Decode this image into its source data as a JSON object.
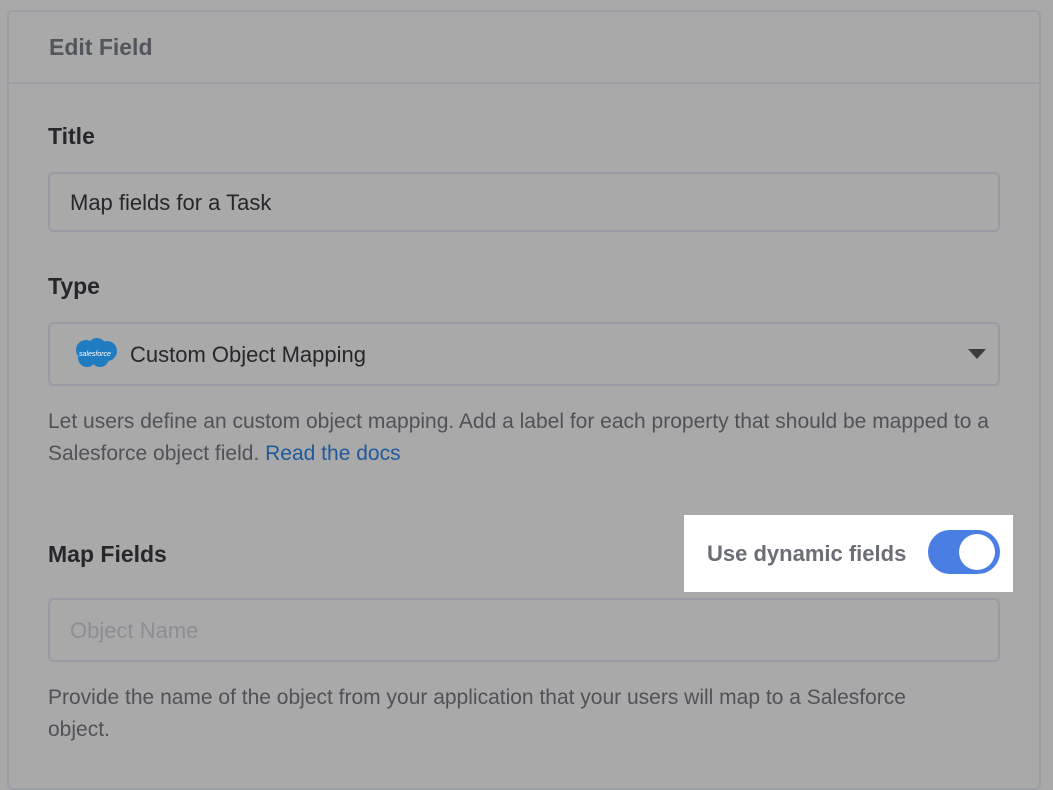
{
  "panel": {
    "title": "Edit Field"
  },
  "title_field": {
    "label": "Title",
    "value": "Map fields for a Task"
  },
  "type_field": {
    "label": "Type",
    "selected": "Custom Object Mapping",
    "icon": "salesforce-logo",
    "icon_text": "salesforce",
    "help_text": "Let users define an custom object mapping. Add a label for each property that should be mapped to a Salesforce object field.",
    "help_link": "Read the docs"
  },
  "map_fields": {
    "label": "Map Fields",
    "toggle_label": "Use dynamic fields",
    "toggle_on": true,
    "object_name_placeholder": "Object Name",
    "help_text": "Provide the name of the object from your application that your users will map to a Salesforce object."
  },
  "colors": {
    "accent": "#4a7ee3",
    "link": "#1f5a9b",
    "salesforce": "#1f7cc0",
    "overlay": "#a9a9a9"
  }
}
